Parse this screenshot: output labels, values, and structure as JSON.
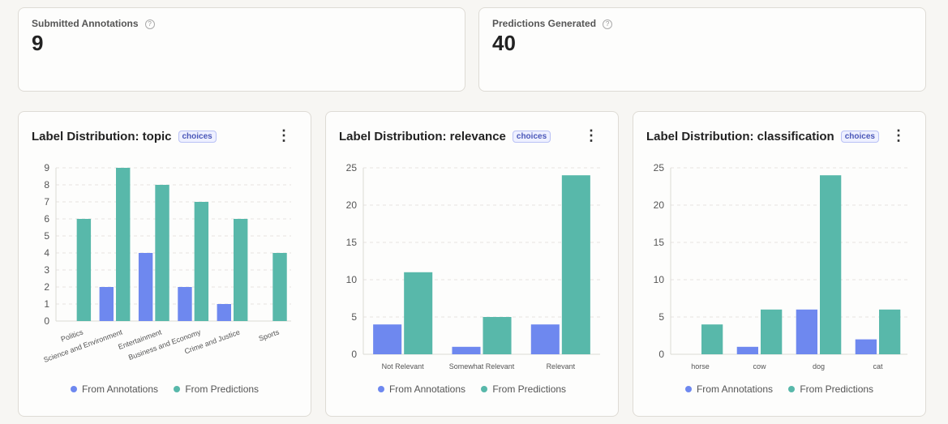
{
  "stats": [
    {
      "label": "Submitted Annotations",
      "value": "9"
    },
    {
      "label": "Predictions Generated",
      "value": "40"
    }
  ],
  "colors": {
    "annotations": "#6e88ef",
    "predictions": "#58b8aa"
  },
  "legend": {
    "annotations": "From Annotations",
    "predictions": "From Predictions"
  },
  "menu_icon": "⋮",
  "chart_data": [
    {
      "type": "bar",
      "title": "Label Distribution: topic",
      "badge": "choices",
      "categories": [
        "Politics",
        "Science and Environment",
        "Entertainment",
        "Business and Economy",
        "Crime and Justice",
        "Sports"
      ],
      "series": [
        {
          "name": "From Annotations",
          "values": [
            0,
            2,
            4,
            2,
            1,
            0
          ]
        },
        {
          "name": "From Predictions",
          "values": [
            6,
            9,
            8,
            7,
            6,
            4
          ]
        }
      ],
      "ylim": [
        0,
        9
      ],
      "yticks": [
        0,
        1,
        2,
        3,
        4,
        5,
        6,
        7,
        8,
        9
      ],
      "grid": true,
      "legend": "bottom",
      "rotated_labels": true
    },
    {
      "type": "bar",
      "title": "Label Distribution: relevance",
      "badge": "choices",
      "categories": [
        "Not Relevant",
        "Somewhat Relevant",
        "Relevant"
      ],
      "series": [
        {
          "name": "From Annotations",
          "values": [
            4,
            1,
            4
          ]
        },
        {
          "name": "From Predictions",
          "values": [
            11,
            5,
            24
          ]
        }
      ],
      "ylim": [
        0,
        25
      ],
      "yticks": [
        0,
        5,
        10,
        15,
        20,
        25
      ],
      "grid": true,
      "legend": "bottom",
      "rotated_labels": false
    },
    {
      "type": "bar",
      "title": "Label Distribution: classification",
      "badge": "choices",
      "categories": [
        "horse",
        "cow",
        "dog",
        "cat"
      ],
      "series": [
        {
          "name": "From Annotations",
          "values": [
            0,
            1,
            6,
            2
          ]
        },
        {
          "name": "From Predictions",
          "values": [
            4,
            6,
            24,
            6
          ]
        }
      ],
      "ylim": [
        0,
        25
      ],
      "yticks": [
        0,
        5,
        10,
        15,
        20,
        25
      ],
      "grid": true,
      "legend": "bottom",
      "rotated_labels": false
    }
  ]
}
